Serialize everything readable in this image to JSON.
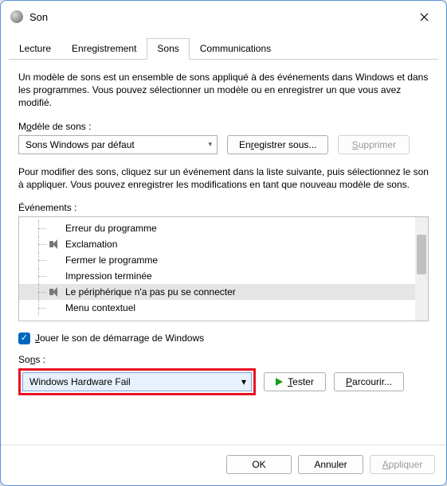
{
  "window": {
    "title": "Son"
  },
  "tabs": [
    "Lecture",
    "Enregistrement",
    "Sons",
    "Communications"
  ],
  "active_tab_index": 2,
  "panel": {
    "description": "Un modèle de sons est un ensemble de sons appliqué à des événements dans Windows et dans les programmes. Vous pouvez sélectionner un modèle ou en enregistrer un que vous avez modifié.",
    "scheme_label_pre": "M",
    "scheme_label_u": "o",
    "scheme_label_post": "dèle de sons :",
    "scheme_value": "Sons Windows par défaut",
    "save_as_pre": "En",
    "save_as_u": "r",
    "save_as_post": "egistrer sous...",
    "delete_u": "S",
    "delete_post": "upprimer",
    "modify_text": "Pour modifier des sons, cliquez sur un événement dans la liste suivante, puis sélectionnez le son à appliquer. Vous pouvez enregistrer les modifications en tant que nouveau modèle de sons.",
    "events_label": "Événements :",
    "events": [
      {
        "label": "Erreur du programme",
        "icon": false,
        "selected": false
      },
      {
        "label": "Exclamation",
        "icon": true,
        "selected": false
      },
      {
        "label": "Fermer le programme",
        "icon": false,
        "selected": false
      },
      {
        "label": "Impression terminée",
        "icon": false,
        "selected": false
      },
      {
        "label": "Le périphérique n'a pas pu se connecter",
        "icon": true,
        "selected": true
      },
      {
        "label": "Menu contextuel",
        "icon": false,
        "selected": false
      }
    ],
    "play_startup_u": "J",
    "play_startup_post": "ouer le son de démarrage de Windows",
    "play_startup_checked": true,
    "sounds_label_pre": "So",
    "sounds_label_u": "n",
    "sounds_label_post": "s :",
    "sound_value": "Windows Hardware Fail",
    "test_u": "T",
    "test_post": "ester",
    "browse_u": "P",
    "browse_post": "arcourir..."
  },
  "footer": {
    "ok": "OK",
    "cancel": "Annuler",
    "apply_u": "A",
    "apply_post": "ppliquer"
  }
}
